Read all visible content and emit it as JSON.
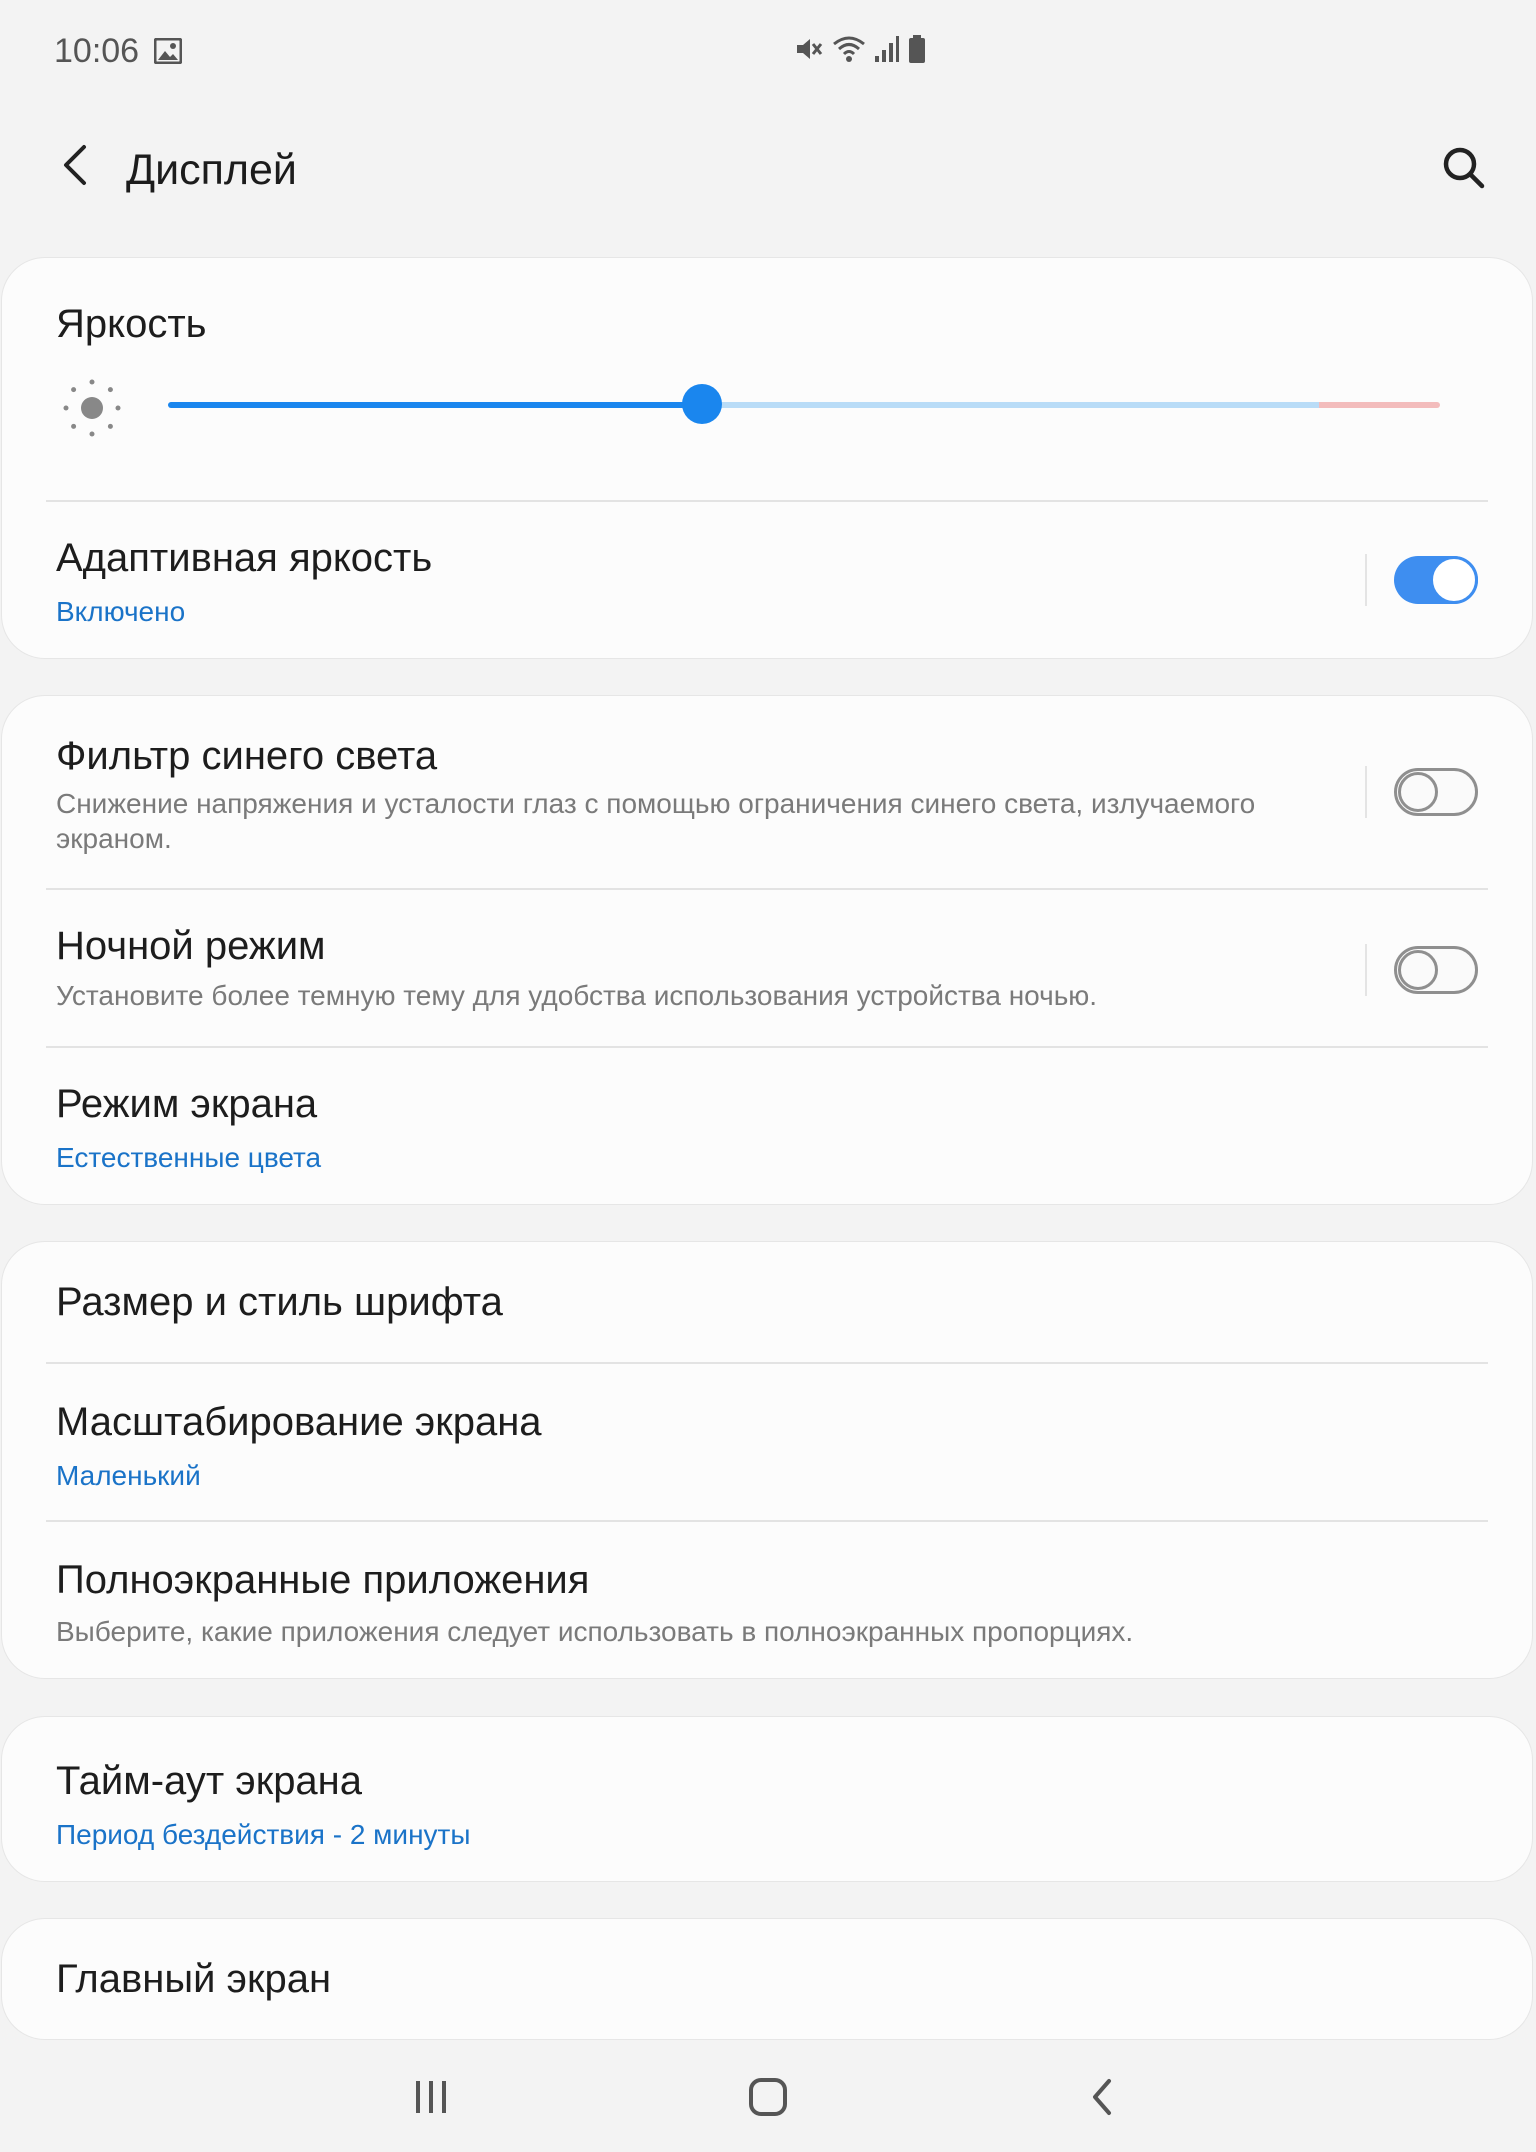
{
  "status": {
    "time": "10:06"
  },
  "header": {
    "title": "Дисплей"
  },
  "brightness": {
    "title": "Яркость",
    "level": 0.42
  },
  "adaptive": {
    "title": "Адаптивная яркость",
    "status": "Включено",
    "enabled": true
  },
  "blue_filter": {
    "title": "Фильтр синего света",
    "description": "Снижение напряжения и усталости глаз с помощью ограничения синего света, излучаемого экраном.",
    "enabled": false
  },
  "night_mode": {
    "title": "Ночной режим",
    "description": "Установите более темную тему для удобства использования устройства ночью.",
    "enabled": false
  },
  "screen_mode": {
    "title": "Режим экрана",
    "value": "Естественные цвета"
  },
  "font": {
    "title": "Размер и стиль шрифта"
  },
  "zoom": {
    "title": "Масштабирование экрана",
    "value": "Маленький"
  },
  "fullscreen": {
    "title": "Полноэкранные приложения",
    "description": "Выберите, какие приложения следует использовать в полноэкранных пропорциях."
  },
  "timeout": {
    "title": "Тайм-аут экрана",
    "value": "Период бездействия - 2 минуты"
  },
  "home": {
    "title": "Главный экран"
  },
  "colors": {
    "accent": "#1a86ee",
    "link": "#1a73c8",
    "background": "#f3f3f3"
  }
}
